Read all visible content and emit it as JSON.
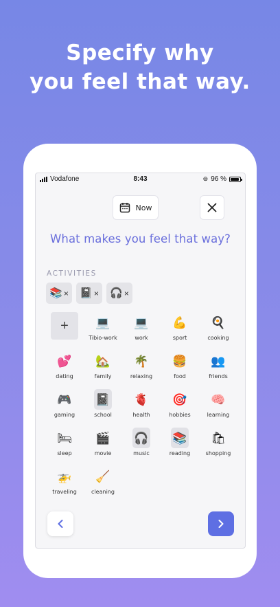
{
  "headline": {
    "line1": "Specify why",
    "line2": "you feel that way."
  },
  "status_bar": {
    "carrier": "Vodafone",
    "time": "8:43",
    "battery": "96 %"
  },
  "header": {
    "now_label": "Now"
  },
  "question": "What makes you feel that way?",
  "section_label": "ACTIVITIES",
  "selected_chips": [
    {
      "emoji": "📚",
      "name": "reading",
      "remove": "×"
    },
    {
      "emoji": "📓",
      "name": "school",
      "remove": "×"
    },
    {
      "emoji": "🎧",
      "name": "music",
      "remove": "×"
    }
  ],
  "activities": [
    {
      "label": "Tibio-work",
      "emoji": "💻",
      "selected": false
    },
    {
      "label": "work",
      "emoji": "💻",
      "selected": false
    },
    {
      "label": "sport",
      "emoji": "💪",
      "selected": false
    },
    {
      "label": "cooking",
      "emoji": "🍳",
      "selected": false
    },
    {
      "label": "dating",
      "emoji": "💕",
      "selected": false
    },
    {
      "label": "family",
      "emoji": "🏡",
      "selected": false
    },
    {
      "label": "relaxing",
      "emoji": "🌴",
      "selected": false
    },
    {
      "label": "food",
      "emoji": "🍔",
      "selected": false
    },
    {
      "label": "friends",
      "emoji": "👥",
      "selected": false
    },
    {
      "label": "gaming",
      "emoji": "🎮",
      "selected": false
    },
    {
      "label": "school",
      "emoji": "📓",
      "selected": true
    },
    {
      "label": "health",
      "emoji": "🫀",
      "selected": false
    },
    {
      "label": "hobbies",
      "emoji": "🎯",
      "selected": false
    },
    {
      "label": "learning",
      "emoji": "🧠",
      "selected": false
    },
    {
      "label": "sleep",
      "emoji": "🛏",
      "selected": false
    },
    {
      "label": "movie",
      "emoji": "🎬",
      "selected": false
    },
    {
      "label": "music",
      "emoji": "🎧",
      "selected": true
    },
    {
      "label": "reading",
      "emoji": "📚",
      "selected": true
    },
    {
      "label": "shopping",
      "emoji": "🛍",
      "selected": false
    },
    {
      "label": "traveling",
      "emoji": "🚁",
      "selected": false
    },
    {
      "label": "cleaning",
      "emoji": "🧹",
      "selected": false
    }
  ],
  "add_label": "+",
  "colors": {
    "accent": "#5e6fe3",
    "question": "#6a6fdc",
    "background_top": "#7787e6",
    "background_bottom": "#a08df0"
  }
}
